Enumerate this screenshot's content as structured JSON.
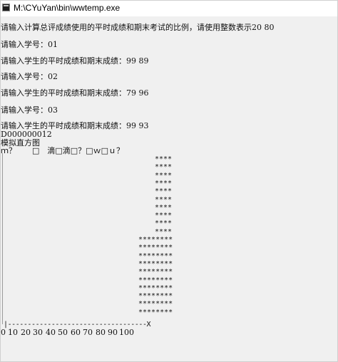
{
  "window": {
    "title": "M:\\CYuYan\\bin\\wwtemp.exe"
  },
  "console": {
    "prompt_intro": "请输入计算总评成绩使用的平时成绩和期末考试的比例，请使用整数表示20 80",
    "students": [
      {
        "id_prompt": "请输入学号：01",
        "score_prompt": "请输入学生的平时成绩和期末成绩：99 89"
      },
      {
        "id_prompt": "请输入学号：02",
        "score_prompt": "请输入学生的平时成绩和期末成绩：79 96"
      },
      {
        "id_prompt": "请输入学号：03",
        "score_prompt": "请输入学生的平时成绩和期末成绩：99 93"
      }
    ],
    "counts_line": "D000000012",
    "histogram_title": "模拟直方图",
    "garbled_line": "ｍ？　　□　滴□滴□？□ｗ□ｕ？",
    "bars": {
      "column_90": {
        "symbol": "****",
        "rows": 10
      },
      "column_80_90": {
        "symbol": "********",
        "rows": 10
      }
    },
    "axis": "|-----------------------------------X",
    "scale": [
      "0",
      "10",
      "20",
      "30",
      "40",
      "50",
      "60",
      "70",
      "80",
      "90",
      "100"
    ]
  }
}
